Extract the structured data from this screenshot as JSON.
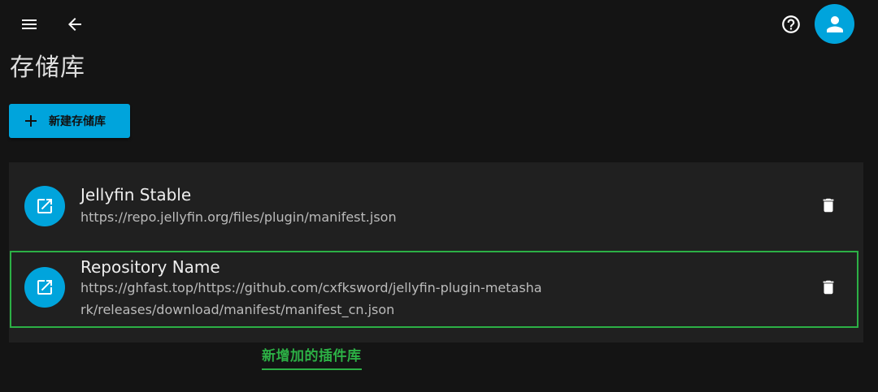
{
  "header": {
    "menu_icon": "menu-icon",
    "back_icon": "arrow-back-icon",
    "help_icon": "help-circle-icon",
    "avatar_icon": "person-icon"
  },
  "page": {
    "title": "存储库",
    "new_button_label": "新建存储库"
  },
  "repositories": [
    {
      "name": "Jellyfin Stable",
      "url": "https://repo.jellyfin.org/files/plugin/manifest.json"
    },
    {
      "name": "Repository Name",
      "url": "https://ghfast.top/https://github.com/cxfksword/jellyfin-plugin-metashark/releases/download/manifest/manifest_cn.json"
    }
  ],
  "annotation": {
    "text": "新增加的插件库"
  },
  "colors": {
    "accent": "#00a4dc",
    "highlight": "#2cb045",
    "background": "#141414",
    "panel": "#202020"
  }
}
